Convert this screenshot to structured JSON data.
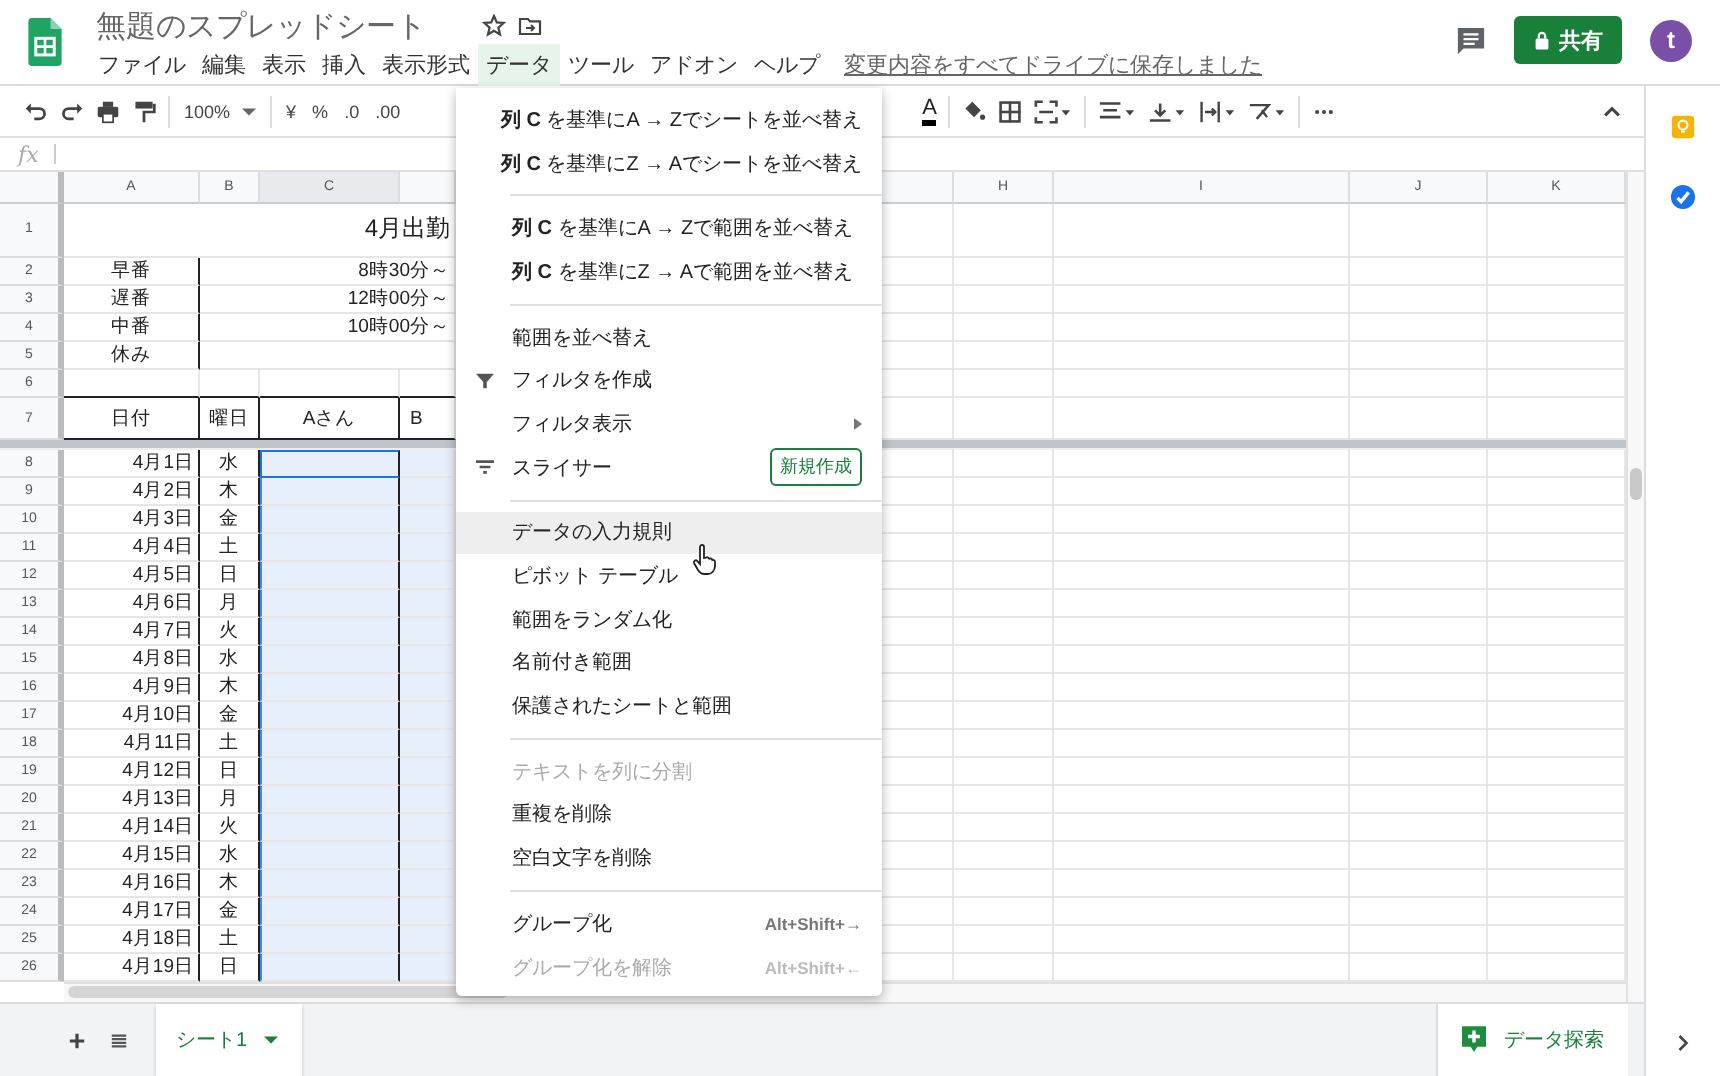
{
  "document": {
    "title": "無題のスプレッドシート",
    "save_status": "変更内容をすべてドライブに保存しました"
  },
  "menu_bar": [
    {
      "label": "ファイル",
      "selected": false
    },
    {
      "label": "編集",
      "selected": false
    },
    {
      "label": "表示",
      "selected": false
    },
    {
      "label": "挿入",
      "selected": false
    },
    {
      "label": "表示形式",
      "selected": false
    },
    {
      "label": "データ",
      "selected": true
    },
    {
      "label": "ツール",
      "selected": false
    },
    {
      "label": "アドオン",
      "selected": false
    },
    {
      "label": "ヘルプ",
      "selected": false
    }
  ],
  "share_button": "共有",
  "avatar": "t",
  "toolbar": {
    "zoom": "100%",
    "currency": "¥",
    "percent": "%",
    "decimal_decrease": ".0",
    "decimal_increase": ".00",
    "text_color": "A"
  },
  "formula_bar": {
    "label": "fx"
  },
  "columns": [
    {
      "label": "A",
      "selected": false
    },
    {
      "label": "B",
      "selected": false
    },
    {
      "label": "C",
      "selected": true
    },
    {
      "label": "H",
      "selected": false
    },
    {
      "label": "I",
      "selected": false
    },
    {
      "label": "J",
      "selected": false
    },
    {
      "label": "K",
      "selected": false
    }
  ],
  "sheet": {
    "title": "4月出勤",
    "shifts": [
      {
        "row": "2",
        "name": "早番",
        "time": "8時30分～"
      },
      {
        "row": "3",
        "name": "遅番",
        "time": "12時00分～"
      },
      {
        "row": "4",
        "name": "中番",
        "time": "10時00分～"
      },
      {
        "row": "5",
        "name": "休み"
      }
    ],
    "blank_row": "6",
    "header_row": {
      "row": "7",
      "cells": [
        "日付",
        "曜日",
        "Aさん",
        "B"
      ]
    },
    "title_row": "1",
    "dates": [
      {
        "row": "8",
        "date": "4月1日",
        "weekday": "水",
        "selected": true,
        "active": true
      },
      {
        "row": "9",
        "date": "4月2日",
        "weekday": "木",
        "selected": true,
        "active": false
      },
      {
        "row": "10",
        "date": "4月3日",
        "weekday": "金",
        "selected": true,
        "active": false
      },
      {
        "row": "11",
        "date": "4月4日",
        "weekday": "土",
        "selected": true,
        "active": false
      },
      {
        "row": "12",
        "date": "4月5日",
        "weekday": "日",
        "selected": true,
        "active": false
      },
      {
        "row": "13",
        "date": "4月6日",
        "weekday": "月",
        "selected": true,
        "active": false
      },
      {
        "row": "14",
        "date": "4月7日",
        "weekday": "火",
        "selected": true,
        "active": false
      },
      {
        "row": "15",
        "date": "4月8日",
        "weekday": "水",
        "selected": true,
        "active": false
      },
      {
        "row": "16",
        "date": "4月9日",
        "weekday": "木",
        "selected": true,
        "active": false
      },
      {
        "row": "17",
        "date": "4月10日",
        "weekday": "金",
        "selected": true,
        "active": false
      },
      {
        "row": "18",
        "date": "4月11日",
        "weekday": "土",
        "selected": true,
        "active": false
      },
      {
        "row": "19",
        "date": "4月12日",
        "weekday": "日",
        "selected": true,
        "active": false
      },
      {
        "row": "20",
        "date": "4月13日",
        "weekday": "月",
        "selected": true,
        "active": false
      },
      {
        "row": "21",
        "date": "4月14日",
        "weekday": "火",
        "selected": true,
        "active": false
      },
      {
        "row": "22",
        "date": "4月15日",
        "weekday": "水",
        "selected": true,
        "active": false
      },
      {
        "row": "23",
        "date": "4月16日",
        "weekday": "木",
        "selected": true,
        "active": false
      },
      {
        "row": "24",
        "date": "4月17日",
        "weekday": "金",
        "selected": true,
        "active": false
      },
      {
        "row": "25",
        "date": "4月18日",
        "weekday": "土",
        "selected": true,
        "active": false
      },
      {
        "row": "26",
        "date": "4月19日",
        "weekday": "日",
        "selected": true,
        "active": false
      }
    ]
  },
  "data_menu": {
    "groups": [
      [
        {
          "kind": "plain",
          "label": "**列 C** を基準にA → Zでシートを並べ替え",
          "disabled": false,
          "highlighted": false
        },
        {
          "kind": "plain",
          "label": "**列 C** を基準にZ → Aでシートを並べ替え",
          "disabled": false,
          "highlighted": false
        }
      ],
      [
        {
          "kind": "plain",
          "label": "**列 C** を基準にA → Zで範囲を並べ替え",
          "disabled": false,
          "highlighted": false
        },
        {
          "kind": "plain",
          "label": "**列 C** を基準にZ → Aで範囲を並べ替え",
          "disabled": false,
          "highlighted": false
        }
      ],
      [
        {
          "kind": "plain",
          "label": "範囲を並べ替え",
          "disabled": false,
          "highlighted": false
        },
        {
          "kind": "filter",
          "label": "フィルタを作成",
          "disabled": false,
          "highlighted": false
        },
        {
          "kind": "submenu",
          "label": "フィルタ表示",
          "disabled": false,
          "highlighted": false
        },
        {
          "kind": "slicer",
          "label": "スライサー",
          "badge": "新規作成",
          "disabled": false,
          "highlighted": false
        }
      ],
      [
        {
          "kind": "plain",
          "label": "データの入力規則",
          "disabled": false,
          "highlighted": true
        },
        {
          "kind": "plain",
          "label": "ピボット テーブル",
          "disabled": false,
          "highlighted": false
        },
        {
          "kind": "plain",
          "label": "範囲をランダム化",
          "disabled": false,
          "highlighted": false
        },
        {
          "kind": "plain",
          "label": "名前付き範囲",
          "disabled": false,
          "highlighted": false
        },
        {
          "kind": "plain",
          "label": "保護されたシートと範囲",
          "disabled": false,
          "highlighted": false
        }
      ],
      [
        {
          "kind": "plain",
          "label": "テキストを列に分割",
          "disabled": true,
          "highlighted": false
        },
        {
          "kind": "plain",
          "label": "重複を削除",
          "disabled": false,
          "highlighted": false
        },
        {
          "kind": "plain",
          "label": "空白文字を削除",
          "disabled": false,
          "highlighted": false
        }
      ],
      [
        {
          "kind": "plain",
          "label": "グループ化",
          "shortcut": "Alt+Shift+→",
          "disabled": false,
          "highlighted": false
        },
        {
          "kind": "plain",
          "label": "グループ化を解除",
          "shortcut": "Alt+Shift+←",
          "disabled": true,
          "highlighted": false
        }
      ]
    ]
  },
  "sheet_tabs": [
    {
      "label": "シート1",
      "selected": true
    }
  ],
  "explore_button": "データ探索"
}
